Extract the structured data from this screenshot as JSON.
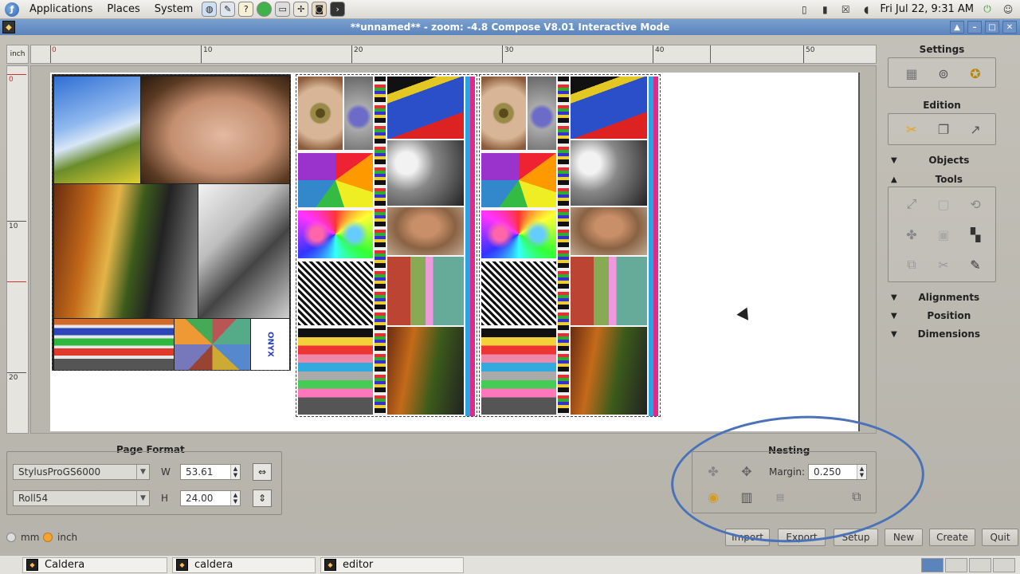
{
  "top_panel": {
    "menus": [
      "Applications",
      "Places",
      "System"
    ],
    "clock": "Fri Jul 22,  9:31 AM"
  },
  "window": {
    "title": "**unnamed** - zoom: -4.8 Compose V8.01 Interactive Mode"
  },
  "rulers": {
    "unit": "inch",
    "top_labels": [
      "0",
      "10",
      "20",
      "30",
      "40",
      "50"
    ],
    "left_labels": [
      "0",
      "10",
      "20"
    ]
  },
  "side_panel": {
    "settings_title": "Settings",
    "edition_title": "Edition",
    "objects_label": "Objects",
    "tools_title": "Tools",
    "alignments_label": "Alignments",
    "position_label": "Position",
    "dimensions_label": "Dimensions"
  },
  "page_format": {
    "title": "Page Format",
    "printer": "StylusProGS6000",
    "media": "Roll54",
    "w_label": "W",
    "w_value": "53.61",
    "h_label": "H",
    "h_value": "24.00",
    "unit_mm": "mm",
    "unit_inch": "inch",
    "selected_unit": "inch"
  },
  "nesting": {
    "title": "Nesting",
    "margin_label": "Margin",
    "margin_value": "0.250"
  },
  "actions": {
    "import": "Import",
    "export": "Export",
    "setup": "Setup",
    "new": "New",
    "create": "Create",
    "quit": "Quit"
  },
  "taskbar": {
    "tasks": [
      "Caldera",
      "caldera",
      "editor"
    ]
  },
  "canvas": {
    "brand_label": "ONYX"
  }
}
